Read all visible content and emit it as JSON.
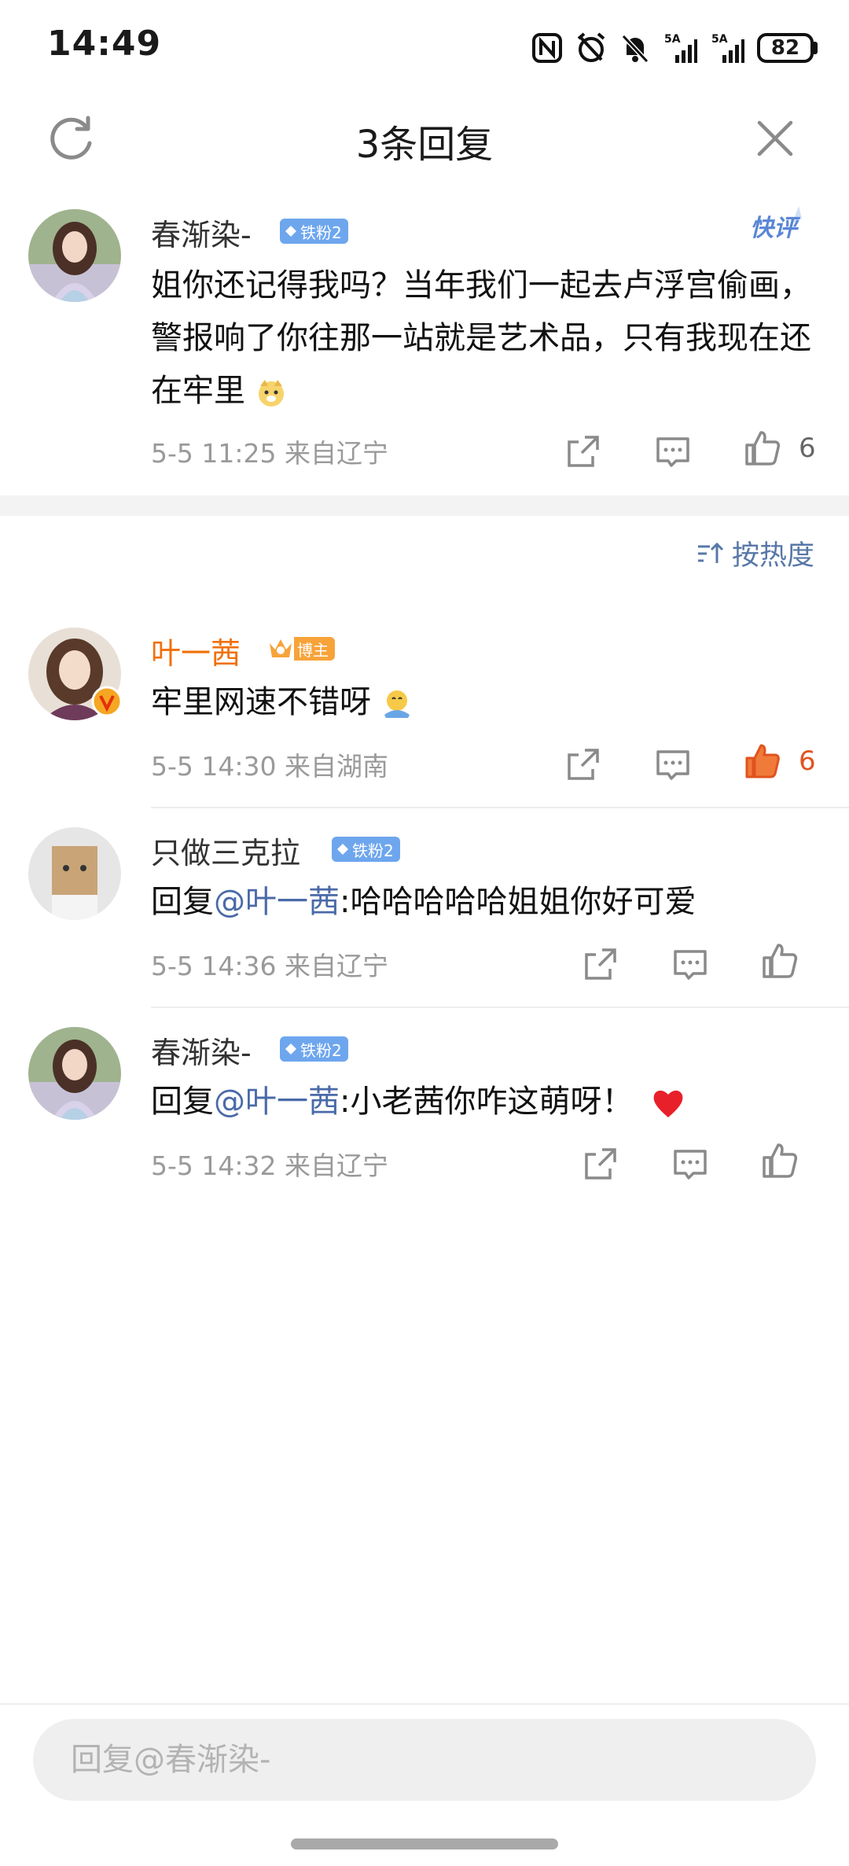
{
  "status_bar": {
    "time": "14:49",
    "signal1_label": "5A",
    "signal2_label": "5A",
    "battery": "82"
  },
  "header": {
    "title": "3条回复"
  },
  "main_comment": {
    "username": "春渐染-",
    "badge": "铁粉2",
    "text": "姐你还记得我吗？当年我们一起去卢浮宫偷画，警报响了你往那一站就是艺术品，只有我现在还在牢里",
    "meta": "5-5 11:25 来自辽宁",
    "likes": "6",
    "kuaiping_label": "快评"
  },
  "sort": {
    "label": "按热度"
  },
  "replies": [
    {
      "username": "叶一茜",
      "badge": "博主",
      "text": "牢里网速不错呀",
      "meta": "5-5 14:30 来自湖南",
      "likes": "6"
    },
    {
      "username": "只做三克拉",
      "badge": "铁粉2",
      "reply_prefix": "回复",
      "mention": "@叶一茜",
      "text": ":哈哈哈哈哈姐姐你好可爱",
      "meta": "5-5 14:36 来自辽宁"
    },
    {
      "username": "春渐染-",
      "badge": "铁粉2",
      "reply_prefix": "回复",
      "mention": "@叶一茜",
      "text": ":小老茜你咋这萌呀！",
      "meta": "5-5 14:32 来自辽宁"
    }
  ],
  "reply_box": {
    "placeholder": "回复@春渐染-"
  },
  "colors": {
    "accent_link": "#4a6aa8",
    "vip_name": "#f0700a",
    "like_active": "#e0531e",
    "fan_badge": "#6ea6ee"
  }
}
